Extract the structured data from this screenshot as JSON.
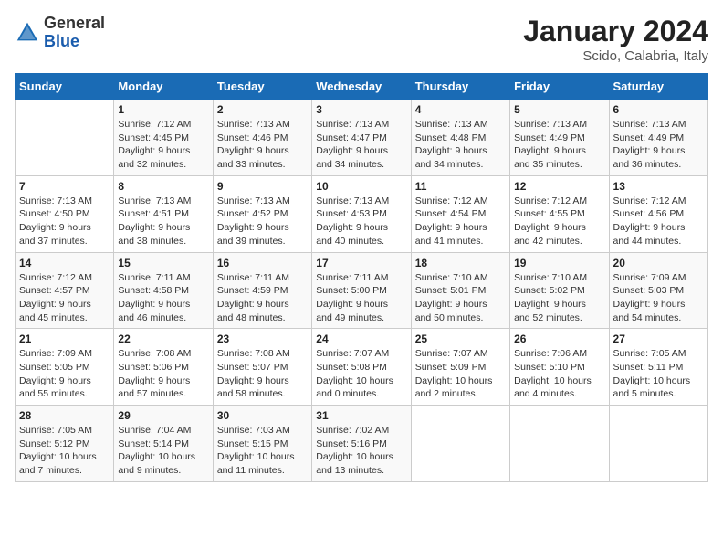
{
  "header": {
    "logo_general": "General",
    "logo_blue": "Blue",
    "title": "January 2024",
    "subtitle": "Scido, Calabria, Italy"
  },
  "calendar": {
    "days_of_week": [
      "Sunday",
      "Monday",
      "Tuesday",
      "Wednesday",
      "Thursday",
      "Friday",
      "Saturday"
    ],
    "weeks": [
      [
        {
          "day": "",
          "info": ""
        },
        {
          "day": "1",
          "info": "Sunrise: 7:12 AM\nSunset: 4:45 PM\nDaylight: 9 hours\nand 32 minutes."
        },
        {
          "day": "2",
          "info": "Sunrise: 7:13 AM\nSunset: 4:46 PM\nDaylight: 9 hours\nand 33 minutes."
        },
        {
          "day": "3",
          "info": "Sunrise: 7:13 AM\nSunset: 4:47 PM\nDaylight: 9 hours\nand 34 minutes."
        },
        {
          "day": "4",
          "info": "Sunrise: 7:13 AM\nSunset: 4:48 PM\nDaylight: 9 hours\nand 34 minutes."
        },
        {
          "day": "5",
          "info": "Sunrise: 7:13 AM\nSunset: 4:49 PM\nDaylight: 9 hours\nand 35 minutes."
        },
        {
          "day": "6",
          "info": "Sunrise: 7:13 AM\nSunset: 4:49 PM\nDaylight: 9 hours\nand 36 minutes."
        }
      ],
      [
        {
          "day": "7",
          "info": "Sunrise: 7:13 AM\nSunset: 4:50 PM\nDaylight: 9 hours\nand 37 minutes."
        },
        {
          "day": "8",
          "info": "Sunrise: 7:13 AM\nSunset: 4:51 PM\nDaylight: 9 hours\nand 38 minutes."
        },
        {
          "day": "9",
          "info": "Sunrise: 7:13 AM\nSunset: 4:52 PM\nDaylight: 9 hours\nand 39 minutes."
        },
        {
          "day": "10",
          "info": "Sunrise: 7:13 AM\nSunset: 4:53 PM\nDaylight: 9 hours\nand 40 minutes."
        },
        {
          "day": "11",
          "info": "Sunrise: 7:12 AM\nSunset: 4:54 PM\nDaylight: 9 hours\nand 41 minutes."
        },
        {
          "day": "12",
          "info": "Sunrise: 7:12 AM\nSunset: 4:55 PM\nDaylight: 9 hours\nand 42 minutes."
        },
        {
          "day": "13",
          "info": "Sunrise: 7:12 AM\nSunset: 4:56 PM\nDaylight: 9 hours\nand 44 minutes."
        }
      ],
      [
        {
          "day": "14",
          "info": "Sunrise: 7:12 AM\nSunset: 4:57 PM\nDaylight: 9 hours\nand 45 minutes."
        },
        {
          "day": "15",
          "info": "Sunrise: 7:11 AM\nSunset: 4:58 PM\nDaylight: 9 hours\nand 46 minutes."
        },
        {
          "day": "16",
          "info": "Sunrise: 7:11 AM\nSunset: 4:59 PM\nDaylight: 9 hours\nand 48 minutes."
        },
        {
          "day": "17",
          "info": "Sunrise: 7:11 AM\nSunset: 5:00 PM\nDaylight: 9 hours\nand 49 minutes."
        },
        {
          "day": "18",
          "info": "Sunrise: 7:10 AM\nSunset: 5:01 PM\nDaylight: 9 hours\nand 50 minutes."
        },
        {
          "day": "19",
          "info": "Sunrise: 7:10 AM\nSunset: 5:02 PM\nDaylight: 9 hours\nand 52 minutes."
        },
        {
          "day": "20",
          "info": "Sunrise: 7:09 AM\nSunset: 5:03 PM\nDaylight: 9 hours\nand 54 minutes."
        }
      ],
      [
        {
          "day": "21",
          "info": "Sunrise: 7:09 AM\nSunset: 5:05 PM\nDaylight: 9 hours\nand 55 minutes."
        },
        {
          "day": "22",
          "info": "Sunrise: 7:08 AM\nSunset: 5:06 PM\nDaylight: 9 hours\nand 57 minutes."
        },
        {
          "day": "23",
          "info": "Sunrise: 7:08 AM\nSunset: 5:07 PM\nDaylight: 9 hours\nand 58 minutes."
        },
        {
          "day": "24",
          "info": "Sunrise: 7:07 AM\nSunset: 5:08 PM\nDaylight: 10 hours\nand 0 minutes."
        },
        {
          "day": "25",
          "info": "Sunrise: 7:07 AM\nSunset: 5:09 PM\nDaylight: 10 hours\nand 2 minutes."
        },
        {
          "day": "26",
          "info": "Sunrise: 7:06 AM\nSunset: 5:10 PM\nDaylight: 10 hours\nand 4 minutes."
        },
        {
          "day": "27",
          "info": "Sunrise: 7:05 AM\nSunset: 5:11 PM\nDaylight: 10 hours\nand 5 minutes."
        }
      ],
      [
        {
          "day": "28",
          "info": "Sunrise: 7:05 AM\nSunset: 5:12 PM\nDaylight: 10 hours\nand 7 minutes."
        },
        {
          "day": "29",
          "info": "Sunrise: 7:04 AM\nSunset: 5:14 PM\nDaylight: 10 hours\nand 9 minutes."
        },
        {
          "day": "30",
          "info": "Sunrise: 7:03 AM\nSunset: 5:15 PM\nDaylight: 10 hours\nand 11 minutes."
        },
        {
          "day": "31",
          "info": "Sunrise: 7:02 AM\nSunset: 5:16 PM\nDaylight: 10 hours\nand 13 minutes."
        },
        {
          "day": "",
          "info": ""
        },
        {
          "day": "",
          "info": ""
        },
        {
          "day": "",
          "info": ""
        }
      ]
    ]
  }
}
